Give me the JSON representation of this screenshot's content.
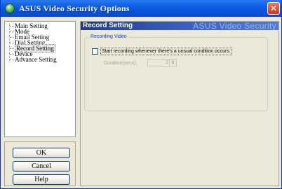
{
  "window": {
    "title": "ASUS Video Security Options",
    "close_icon": "close-icon"
  },
  "sidebar": {
    "items": [
      {
        "label": "Main Setting",
        "selected": false
      },
      {
        "label": "Mode",
        "selected": false
      },
      {
        "label": "Email Setting",
        "selected": false
      },
      {
        "label": "Dial Setting",
        "selected": false
      },
      {
        "label": "Record Setting",
        "selected": true
      },
      {
        "label": "Device",
        "selected": false
      },
      {
        "label": "Advance Setting",
        "selected": false
      }
    ],
    "buttons": {
      "ok": "OK",
      "cancel": "Cancel",
      "help": "Help"
    }
  },
  "main": {
    "header_title": "Record Setting",
    "header_brand": "ASUS Video Security",
    "group": {
      "legend": "Recording Video",
      "checkbox_label": "Start recording whenever there's a unsual condition occurs.",
      "checkbox_checked": false,
      "duration_label": "Duration(secs):",
      "duration_value": "2",
      "duration_enabled": false
    }
  },
  "colors": {
    "titlebar": "#0a5be0",
    "header": "#1f3a8a",
    "legend": "#0046d5"
  }
}
